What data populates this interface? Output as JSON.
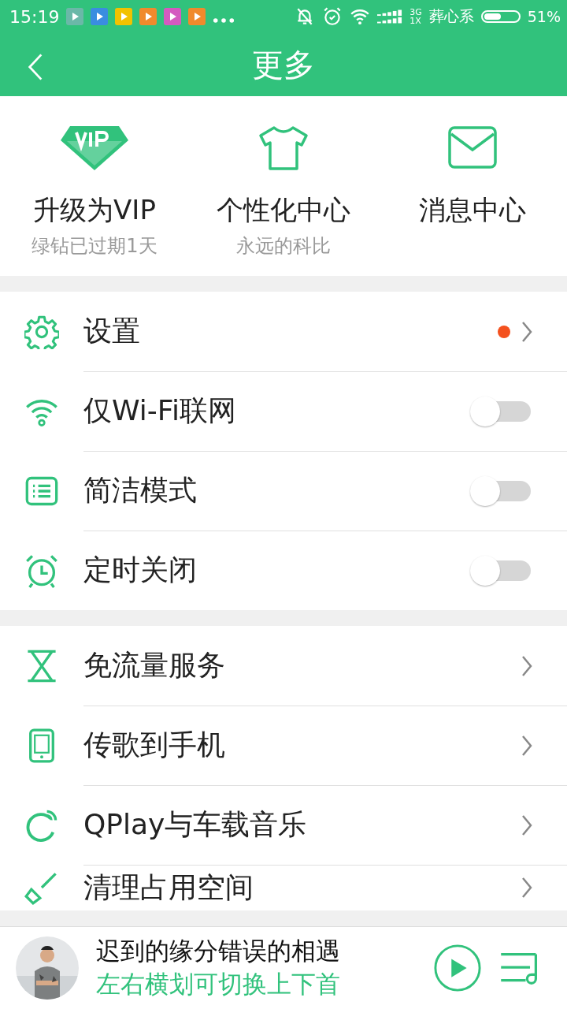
{
  "status_bar": {
    "time": "15:19",
    "network_top": "3G",
    "network_bottom": "1X",
    "carrier": "葬心系",
    "battery_text": "51%"
  },
  "header": {
    "title": "更多"
  },
  "shortcuts": [
    {
      "label": "升级为VIP",
      "sub": "绿钻已过期1天"
    },
    {
      "label": "个性化中心",
      "sub": "永远的科比"
    },
    {
      "label": "消息中心"
    }
  ],
  "groups": [
    {
      "items": [
        {
          "label": "设置",
          "kind": "link",
          "dot": true
        },
        {
          "label": "仅Wi-Fi联网",
          "kind": "toggle",
          "on": false
        },
        {
          "label": "简洁模式",
          "kind": "toggle",
          "on": false
        },
        {
          "label": "定时关闭",
          "kind": "toggle",
          "on": false
        }
      ]
    },
    {
      "items": [
        {
          "label": "免流量服务",
          "kind": "link",
          "dot": false
        },
        {
          "label": "传歌到手机",
          "kind": "link",
          "dot": false
        },
        {
          "label": "QPlay与车载音乐",
          "kind": "link",
          "dot": false
        },
        {
          "label": "清理占用空间",
          "kind": "link",
          "dot": false
        }
      ]
    }
  ],
  "player": {
    "title": "迟到的缘分错误的相遇",
    "hint": "左右横划可切换上下首"
  }
}
